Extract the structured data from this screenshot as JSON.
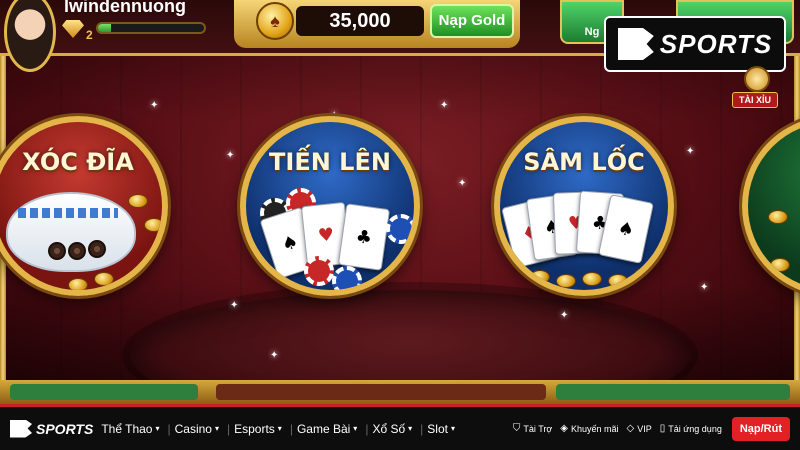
{
  "header": {
    "username": "lwindennuong",
    "vip_level": "2",
    "coin_balance": "35,000",
    "nap_gold_label": "Nạp Gold",
    "right_button_1_label": "Ng",
    "tai_xiu_label": "TÀI XỈU",
    "xp_progress_percent": 12
  },
  "brand": {
    "name": "SPORTS",
    "accent_color": "#e32125"
  },
  "games": [
    {
      "label": "XÓC ĐĨA"
    },
    {
      "label": "TIẾN LÊN"
    },
    {
      "label": "SÂM LỐC"
    }
  ],
  "footer": {
    "logo_text": "SPORTS",
    "nav": [
      {
        "label": "Thể Thao"
      },
      {
        "label": "Casino"
      },
      {
        "label": "Esports"
      },
      {
        "label": "Game Bài"
      },
      {
        "label": "Xổ Số"
      },
      {
        "label": "Slot"
      }
    ],
    "utilities": [
      {
        "label": "Tài Trợ",
        "icon": "shield-icon"
      },
      {
        "label": "Khuyến mãi",
        "icon": "tag-icon"
      },
      {
        "label": "VIP",
        "icon": "diamond-icon"
      },
      {
        "label": "Tải ứng dụng",
        "icon": "phone-icon"
      }
    ],
    "cta_label": "Nạp/Rút"
  }
}
